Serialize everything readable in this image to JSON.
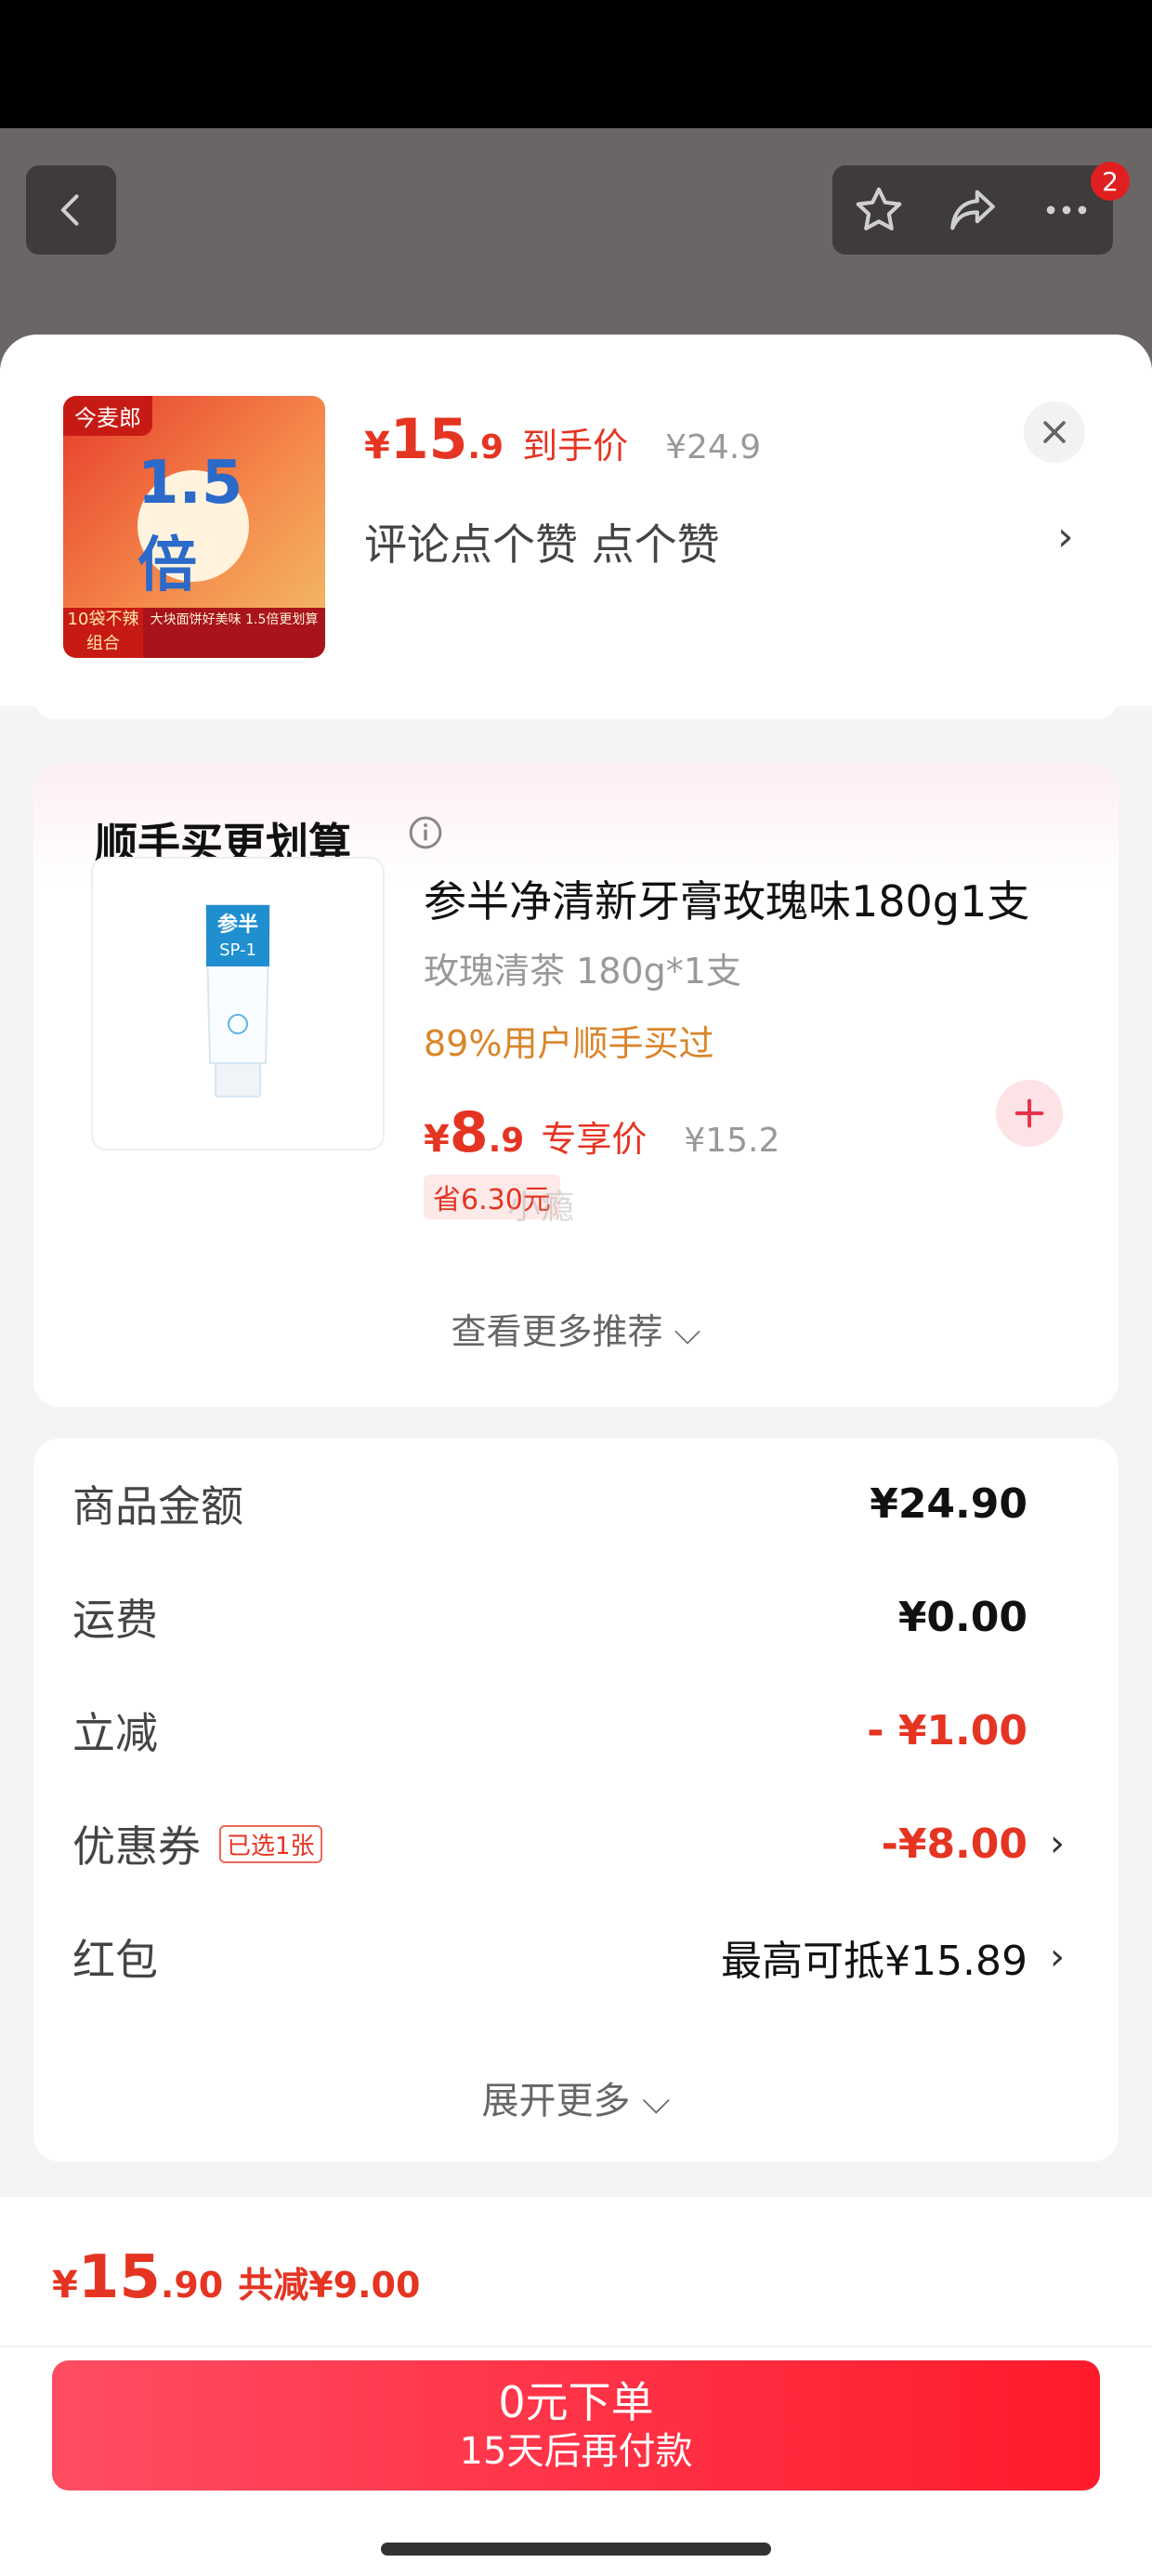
{
  "header": {
    "notification_count": "2",
    "icons": [
      "back-icon",
      "star-icon",
      "share-icon",
      "more-icon"
    ]
  },
  "product": {
    "thumb_brand": "今麦郎",
    "thumb_badge": "1.5倍",
    "thumb_count": "10袋不辣组合",
    "thumb_strip": "大块面饼好美味 1.5倍更划算",
    "price_symbol": "¥",
    "price_int": "15",
    "price_dec": ".9",
    "price_label": "到手价",
    "original_price": "¥24.9",
    "spec_text": "评论点个赞  点个赞",
    "spec_arrow": "›"
  },
  "recommend": {
    "title": "顺手买更划算",
    "item": {
      "name": "参半净清新牙膏玫瑰味180g1支",
      "variant": "玫瑰清茶 180g*1支",
      "social_proof": "89%用户顺手买过",
      "price_symbol": "¥",
      "price_int": "8",
      "price_dec": ".9",
      "price_label": "专享价",
      "original_price": "¥15.2",
      "save_tag": "省6.30元",
      "thumb_brand": "参半",
      "thumb_model": "SP-1"
    },
    "watermark": "小瘾",
    "more_label": "查看更多推荐 ⌵"
  },
  "summary": {
    "rows": [
      {
        "label": "商品金额",
        "value": "¥24.90"
      },
      {
        "label": "运费",
        "value": "¥0.00"
      },
      {
        "label": "立减",
        "value": "- ¥1.00"
      },
      {
        "label": "优惠券",
        "tag": "已选1张",
        "value": "-¥8.00",
        "arrow": "›"
      },
      {
        "label": "红包",
        "value": "最高可抵¥15.89",
        "arrow": "›"
      }
    ],
    "expand_label": "展开更多 ⌵"
  },
  "footer": {
    "total_symbol": "¥",
    "total_int": "15",
    "total_dec": ".90",
    "total_saved": "共减¥9.00",
    "order_main": "0元下单",
    "order_sub": "15天后再付款"
  },
  "colors": {
    "accent": "#e53422",
    "button_start": "#ff4c62",
    "button_end": "#ff1a2c",
    "social_proof": "#d9852a"
  }
}
